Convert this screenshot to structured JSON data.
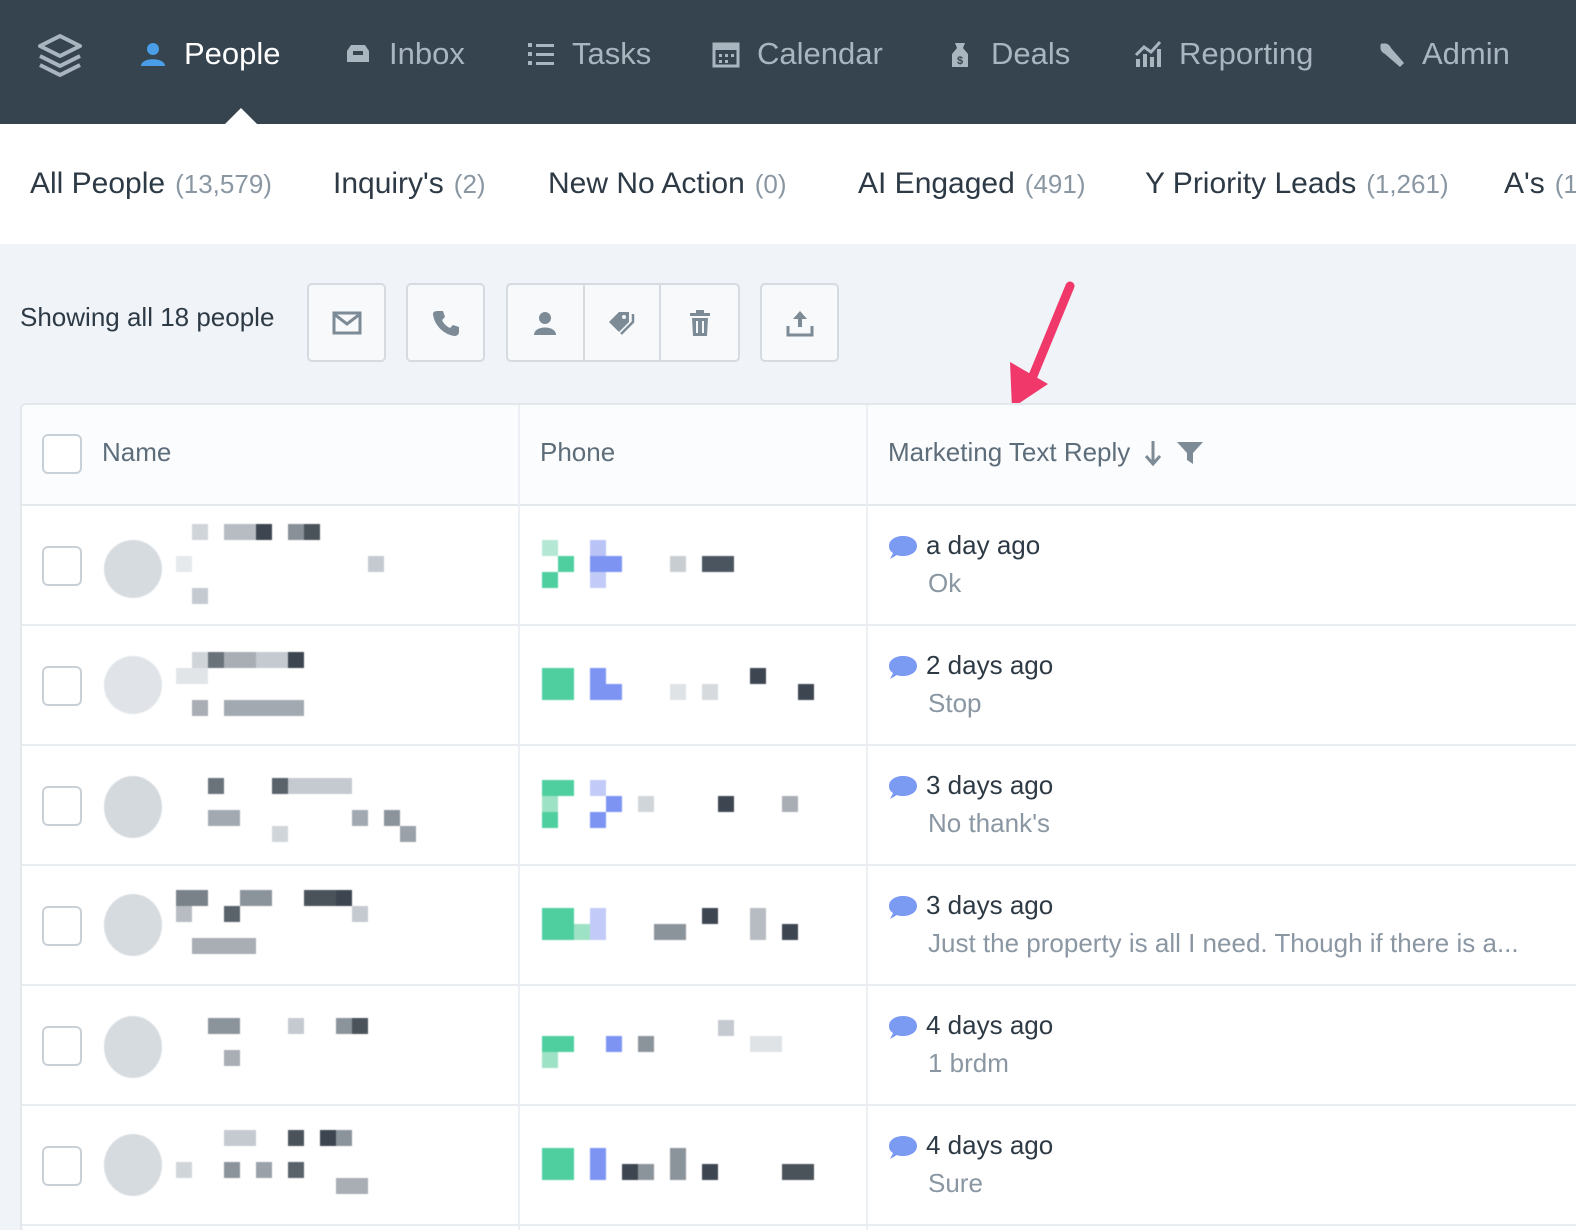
{
  "nav": {
    "items": [
      {
        "label": "People",
        "icon": "people-icon",
        "active": true
      },
      {
        "label": "Inbox",
        "icon": "inbox-icon"
      },
      {
        "label": "Tasks",
        "icon": "tasks-icon"
      },
      {
        "label": "Calendar",
        "icon": "calendar-icon"
      },
      {
        "label": "Deals",
        "icon": "deals-icon"
      },
      {
        "label": "Reporting",
        "icon": "reporting-icon"
      },
      {
        "label": "Admin",
        "icon": "wrench-icon"
      }
    ]
  },
  "lists": [
    {
      "label": "All People",
      "count": "(13,579)"
    },
    {
      "label": "Inquiry's",
      "count": "(2)"
    },
    {
      "label": "New No Action",
      "count": "(0)"
    },
    {
      "label": "AI Engaged",
      "count": "(491)"
    },
    {
      "label": "Y Priority Leads",
      "count": "(1,261)"
    },
    {
      "label": "A's",
      "count": "(1"
    }
  ],
  "toolbar": {
    "showing": "Showing all 18 people",
    "buttons": [
      "email-icon",
      "phone-icon",
      "assign-icon",
      "tag-icon",
      "trash-icon",
      "export-icon"
    ]
  },
  "table": {
    "headers": {
      "name": "Name",
      "phone": "Phone",
      "reply": "Marketing Text Reply"
    },
    "rows": [
      {
        "time": "a day ago",
        "message": "Ok"
      },
      {
        "time": "2 days ago",
        "message": "Stop"
      },
      {
        "time": "3 days ago",
        "message": "No thank's"
      },
      {
        "time": "3 days ago",
        "message": "Just the property is all I need. Though if there is a..."
      },
      {
        "time": "4 days ago",
        "message": "1 brdm"
      },
      {
        "time": "4 days ago",
        "message": "Sure"
      }
    ]
  },
  "colors": {
    "nav_bg": "#36444f",
    "accent_blue": "#6f8ff0",
    "annotation_arrow": "#f0386b"
  }
}
